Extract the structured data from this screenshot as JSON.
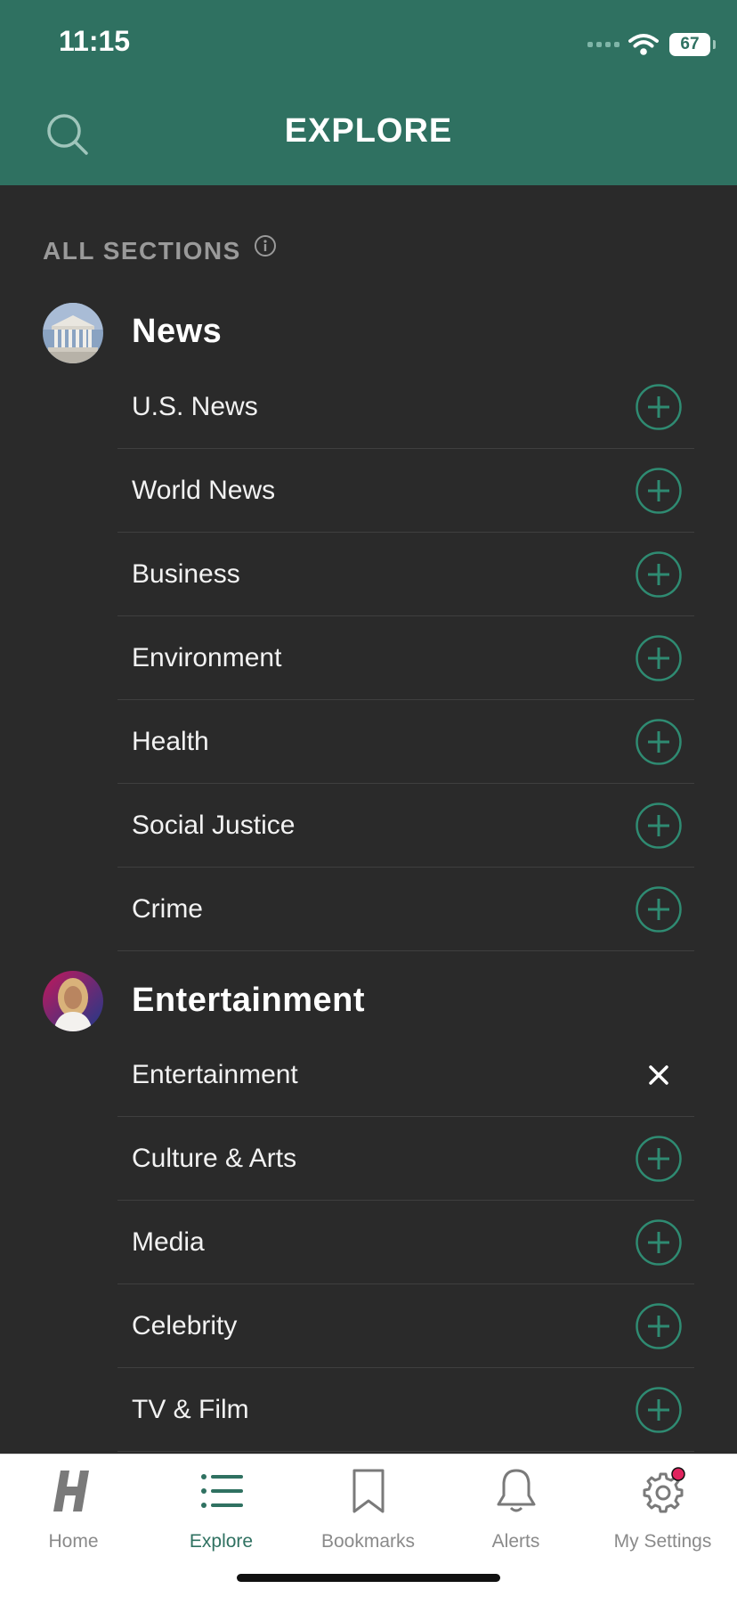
{
  "status_bar": {
    "time": "11:15",
    "battery": "67"
  },
  "header": {
    "title": "EXPLORE"
  },
  "all_sections_label": "ALL SECTIONS",
  "groups": [
    {
      "title": "News",
      "items": [
        {
          "label": "U.S. News",
          "action": "add"
        },
        {
          "label": "World News",
          "action": "add"
        },
        {
          "label": "Business",
          "action": "add"
        },
        {
          "label": "Environment",
          "action": "add"
        },
        {
          "label": "Health",
          "action": "add"
        },
        {
          "label": "Social Justice",
          "action": "add"
        },
        {
          "label": "Crime",
          "action": "add"
        }
      ]
    },
    {
      "title": "Entertainment",
      "items": [
        {
          "label": "Entertainment",
          "action": "remove"
        },
        {
          "label": "Culture & Arts",
          "action": "add"
        },
        {
          "label": "Media",
          "action": "add"
        },
        {
          "label": "Celebrity",
          "action": "add"
        },
        {
          "label": "TV & Film",
          "action": "add"
        }
      ]
    }
  ],
  "tabbar": {
    "items": [
      {
        "label": "Home",
        "icon": "h-logo-icon"
      },
      {
        "label": "Explore",
        "icon": "list-icon",
        "active": true
      },
      {
        "label": "Bookmarks",
        "icon": "bookmark-icon"
      },
      {
        "label": "Alerts",
        "icon": "bell-icon"
      },
      {
        "label": "My Settings",
        "icon": "gear-icon",
        "badge": true
      }
    ]
  },
  "colors": {
    "brand": "#2f7161",
    "background": "#2a2a2a",
    "badge": "#e0245e"
  }
}
